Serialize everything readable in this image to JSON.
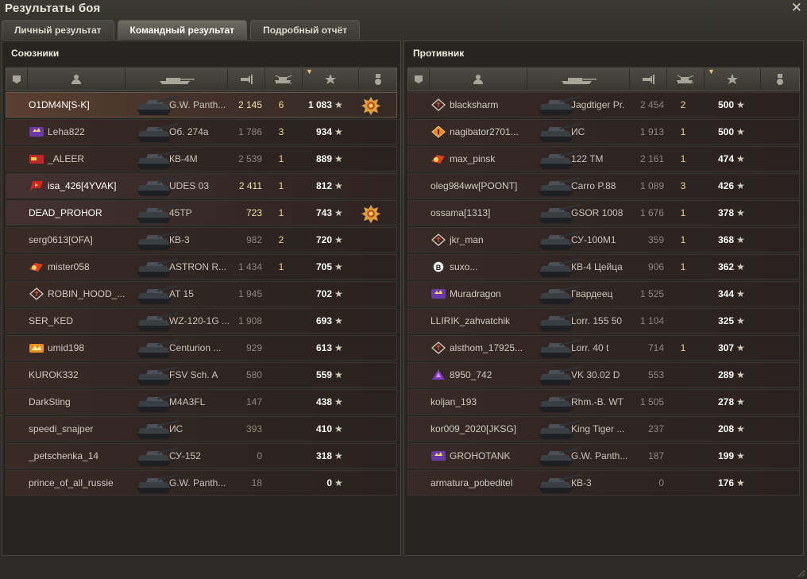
{
  "window": {
    "title": "Результаты боя"
  },
  "tabs": [
    {
      "label": "Личный результат",
      "active": false
    },
    {
      "label": "Командный результат",
      "active": true
    },
    {
      "label": "Подробный отчёт",
      "active": false
    }
  ],
  "colors": {
    "accent": "#e8c86c",
    "medal": "#e0a040"
  },
  "allies": {
    "title": "Союзники",
    "rows": [
      {
        "name": "O1DM4N[S-K]",
        "tank": "G.W. Panth...",
        "damage": "2 145",
        "kills": "6",
        "xp": "1 083",
        "medal": true,
        "type": "me",
        "badge": ""
      },
      {
        "name": "Leha822",
        "tank": "Об. 274а",
        "damage": "1 786",
        "kills": "3",
        "xp": "934",
        "medal": false,
        "type": "ally",
        "badge": "purple"
      },
      {
        "name": "_ALEER",
        "tank": "КВ-4М",
        "damage": "2 539",
        "kills": "1",
        "xp": "889",
        "medal": false,
        "type": "ally",
        "badge": "red"
      },
      {
        "name": "isa_426[4YVAK]",
        "tank": "UDES 03",
        "damage": "2 411",
        "kills": "1",
        "xp": "812",
        "medal": false,
        "type": "squad",
        "badge": "redflag"
      },
      {
        "name": "DEAD_PROHOR",
        "tank": "45TP",
        "damage": "723",
        "kills": "1",
        "xp": "743",
        "medal": true,
        "type": "squad",
        "badge": ""
      },
      {
        "name": "serg0613[OFA]",
        "tank": "КВ-3",
        "damage": "982",
        "kills": "2",
        "xp": "720",
        "medal": false,
        "type": "ally",
        "badge": ""
      },
      {
        "name": "mister058",
        "tank": "ASTRON R...",
        "damage": "1 434",
        "kills": "1",
        "xp": "705",
        "medal": false,
        "type": "ally",
        "badge": "redorange"
      },
      {
        "name": "ROBIN_HOOD_...",
        "tank": "AT 15",
        "damage": "1 945",
        "kills": "",
        "xp": "702",
        "medal": false,
        "type": "ally",
        "badge": "diamond"
      },
      {
        "name": "SER_KED",
        "tank": "WZ-120-1G ...",
        "damage": "1 908",
        "kills": "",
        "xp": "693",
        "medal": false,
        "type": "ally",
        "badge": ""
      },
      {
        "name": "umid198",
        "tank": "Centurion ...",
        "damage": "929",
        "kills": "",
        "xp": "613",
        "medal": false,
        "type": "ally",
        "badge": "orange"
      },
      {
        "name": "KUROK332",
        "tank": "FSV Sch. A",
        "damage": "580",
        "kills": "",
        "xp": "559",
        "medal": false,
        "type": "ally",
        "badge": ""
      },
      {
        "name": "DarkSting",
        "tank": "M4A3FL",
        "damage": "147",
        "kills": "",
        "xp": "438",
        "medal": false,
        "type": "ally",
        "badge": ""
      },
      {
        "name": "speedi_snajper",
        "tank": "ИС",
        "damage": "393",
        "kills": "",
        "xp": "410",
        "medal": false,
        "type": "ally",
        "badge": ""
      },
      {
        "name": "_petschenka_14",
        "tank": "СУ-152",
        "damage": "0",
        "kills": "",
        "xp": "318",
        "medal": false,
        "type": "ally",
        "badge": ""
      },
      {
        "name": "prince_of_all_russie",
        "tank": "G.W. Panth...",
        "damage": "18",
        "kills": "",
        "xp": "0",
        "medal": false,
        "type": "ally",
        "badge": ""
      }
    ]
  },
  "enemies": {
    "title": "Противник",
    "rows": [
      {
        "name": "blacksharm",
        "tank": "Jagdtiger Pr.",
        "damage": "2 454",
        "kills": "2",
        "xp": "500",
        "badge": "diamond"
      },
      {
        "name": "nagibator2701...",
        "tank": "ИС",
        "damage": "1 913",
        "kills": "1",
        "xp": "500",
        "badge": "diamondorange"
      },
      {
        "name": "max_pinsk",
        "tank": "122 TM",
        "damage": "2 161",
        "kills": "1",
        "xp": "474",
        "badge": "redorange"
      },
      {
        "name": "oleg984ww[POONT]",
        "tank": "Carro P.88",
        "damage": "1 089",
        "kills": "3",
        "xp": "426",
        "badge": ""
      },
      {
        "name": "ossama[1313]",
        "tank": "GSOR 1008",
        "damage": "1 676",
        "kills": "1",
        "xp": "378",
        "badge": ""
      },
      {
        "name": "jkr_man",
        "tank": "СУ-100М1",
        "damage": "359",
        "kills": "1",
        "xp": "368",
        "badge": "diamond"
      },
      {
        "name": "suxo...",
        "tank": "КВ-4 Цейца",
        "damage": "906",
        "kills": "1",
        "xp": "362",
        "badge": "coin"
      },
      {
        "name": "Muradragon",
        "tank": "Гвардеец",
        "damage": "1 525",
        "kills": "",
        "xp": "344",
        "badge": "purple"
      },
      {
        "name": "LLIRIK_zahvatchik",
        "tank": "Lorr. 155 50",
        "damage": "1 104",
        "kills": "",
        "xp": "325",
        "badge": ""
      },
      {
        "name": "alsthom_17925...",
        "tank": "Lorr. 40 t",
        "damage": "714",
        "kills": "1",
        "xp": "307",
        "badge": "diamond"
      },
      {
        "name": "8950_742",
        "tank": "VK 30.02 D",
        "damage": "553",
        "kills": "",
        "xp": "289",
        "badge": "violet"
      },
      {
        "name": "koljan_193",
        "tank": "Rhm.-B. WT",
        "damage": "1 505",
        "kills": "",
        "xp": "278",
        "badge": ""
      },
      {
        "name": "kor009_2020[JKSG]",
        "tank": "King Tiger ...",
        "damage": "237",
        "kills": "",
        "xp": "208",
        "badge": ""
      },
      {
        "name": "GROHOTANK",
        "tank": "G.W. Panth...",
        "damage": "187",
        "kills": "",
        "xp": "199",
        "badge": "purple"
      },
      {
        "name": "armatura_pobeditel",
        "tank": "КВ-3",
        "damage": "0",
        "kills": "",
        "xp": "176",
        "badge": ""
      }
    ]
  },
  "icons": {
    "star": "★",
    "close": "✕"
  }
}
